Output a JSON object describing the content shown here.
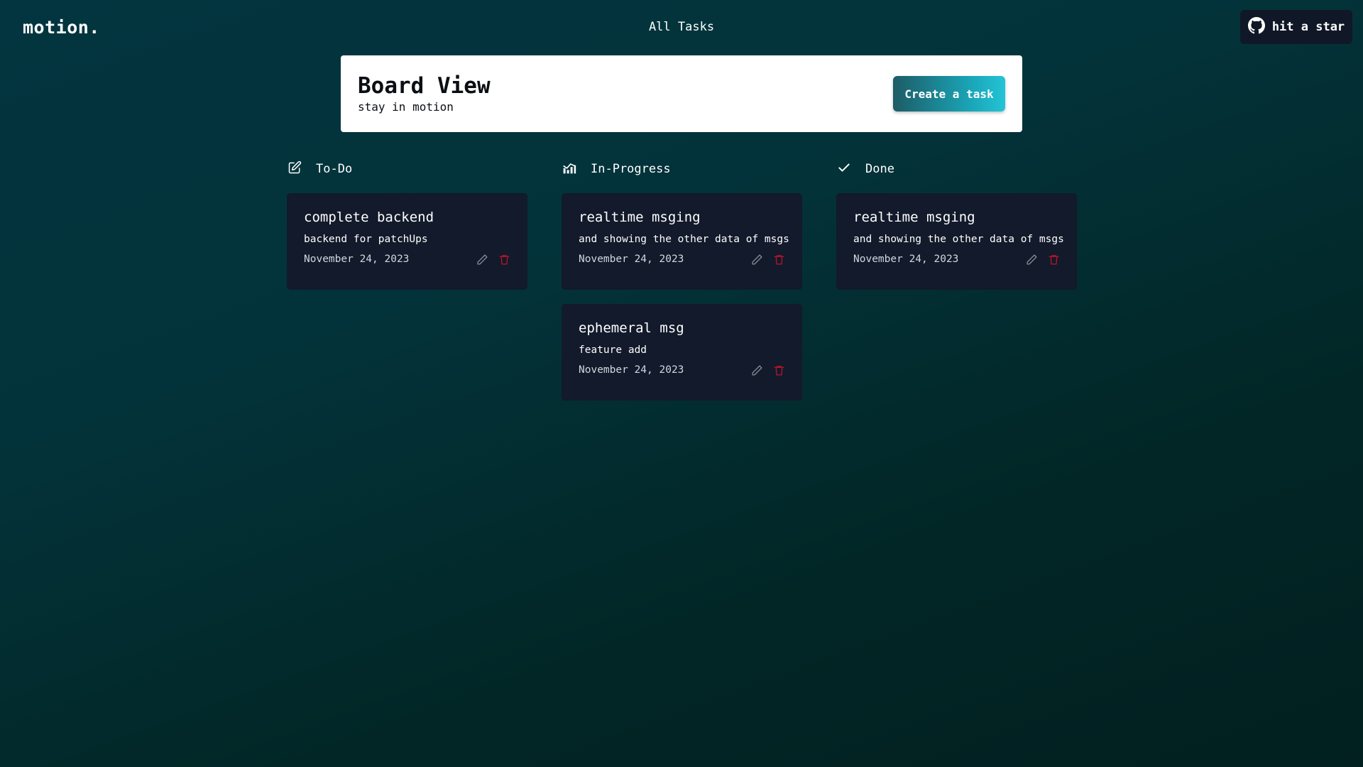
{
  "app": {
    "logo": "motion.",
    "nav_title": "All Tasks",
    "github_label": "hit a star"
  },
  "header": {
    "title": "Board View",
    "subtitle": "stay in motion",
    "create_label": "Create a task"
  },
  "columns": [
    {
      "title": "To-Do",
      "icon": "edit-square-icon",
      "cards": [
        {
          "title": "complete backend",
          "desc": "backend for patchUps",
          "date": "November 24, 2023"
        }
      ]
    },
    {
      "title": "In-Progress",
      "icon": "bar-chart-icon",
      "cards": [
        {
          "title": "realtime msging",
          "desc": "and showing the other data of msgs",
          "date": "November 24, 2023"
        },
        {
          "title": "ephemeral msg",
          "desc": "feature add",
          "date": "November 24, 2023"
        }
      ]
    },
    {
      "title": "Done",
      "icon": "check-icon",
      "cards": [
        {
          "title": "realtime msging",
          "desc": "and showing the other data of msgs",
          "date": "November 24, 2023"
        }
      ]
    }
  ],
  "colors": {
    "card_bg": "#121a2b",
    "delete_icon": "#c0132b",
    "edit_icon": "#8a8f98",
    "button_gradient_start": "#1d5c66",
    "button_gradient_end": "#23c4d6"
  }
}
